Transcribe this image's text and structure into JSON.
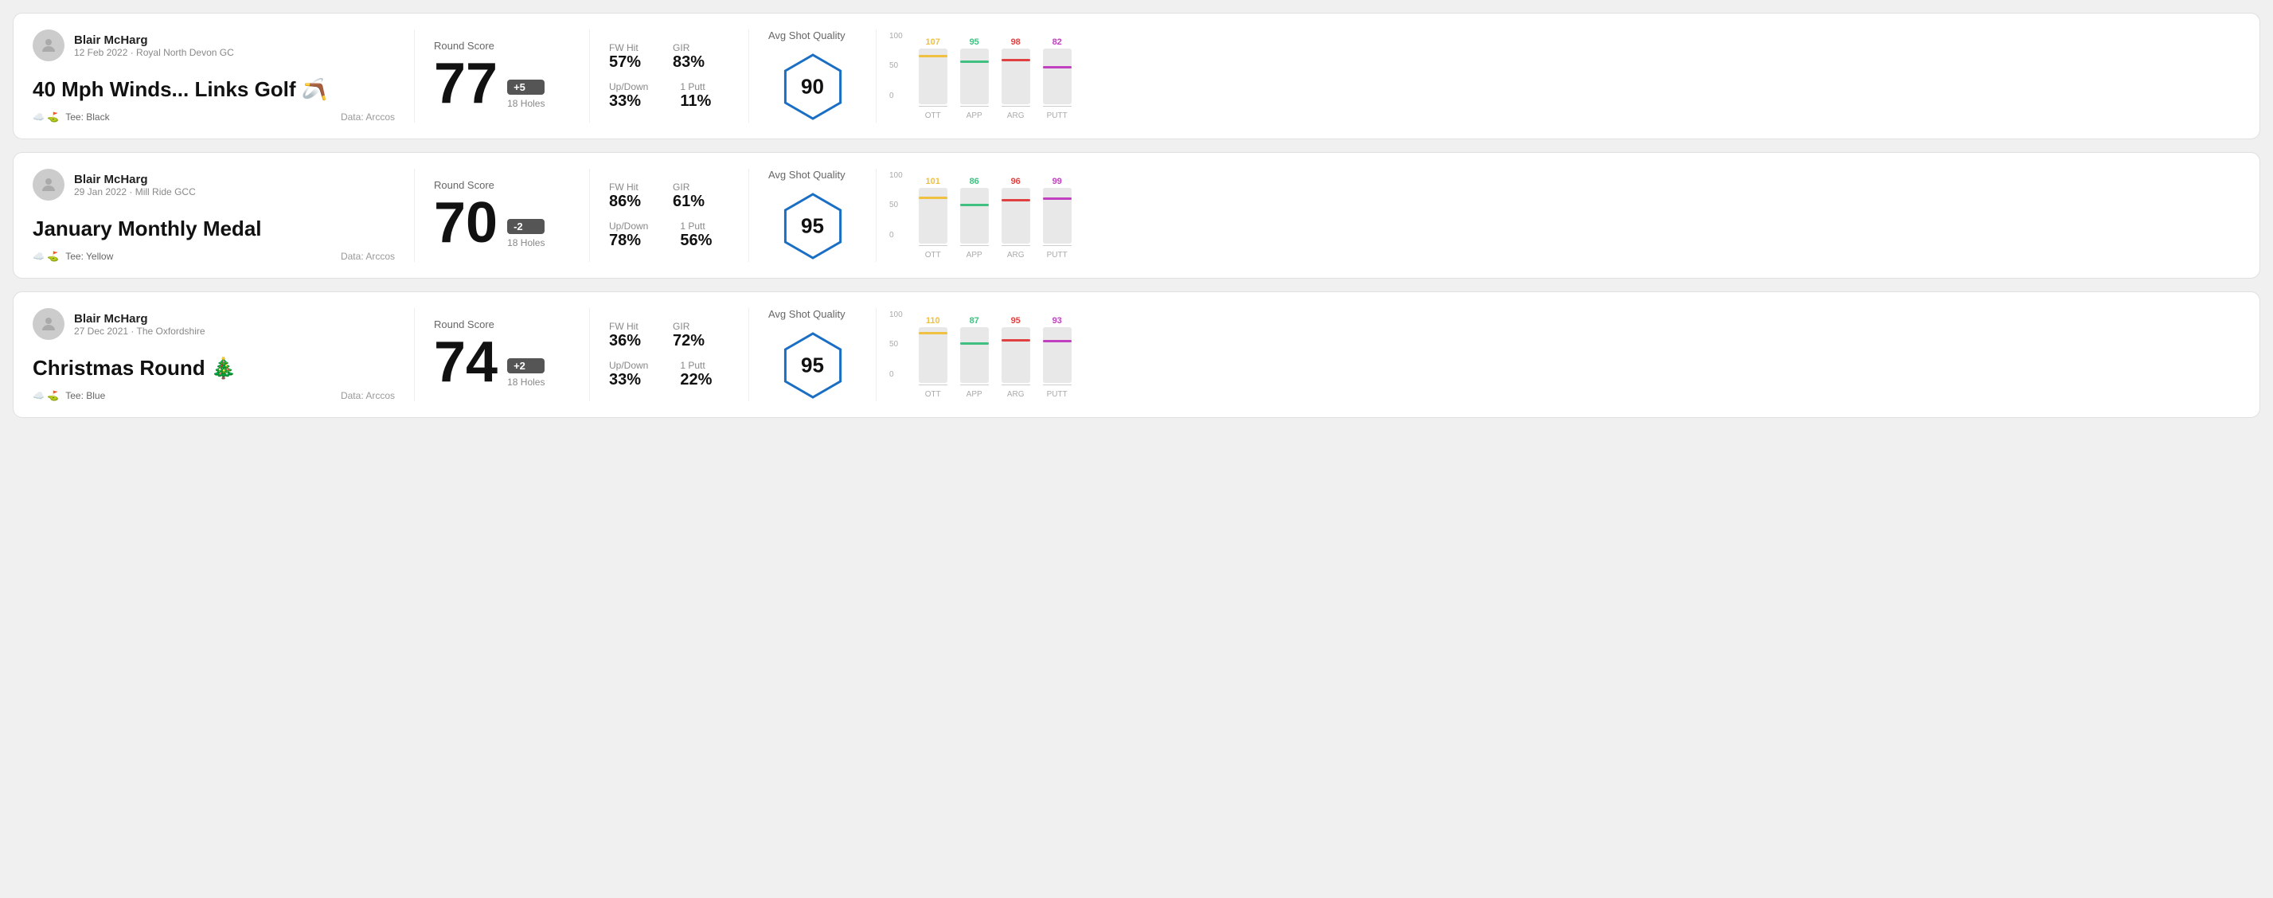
{
  "rounds": [
    {
      "id": "round1",
      "player": "Blair McHarg",
      "date": "12 Feb 2022 · Royal North Devon GC",
      "title": "40 Mph Winds... Links Golf 🪃",
      "tee": "Black",
      "data_source": "Data: Arccos",
      "score": "77",
      "score_diff": "+5",
      "score_diff_type": "over",
      "holes": "18 Holes",
      "fw_hit": "57%",
      "gir": "83%",
      "up_down": "33%",
      "one_putt": "11%",
      "avg_quality": "90",
      "chart": {
        "bars": [
          {
            "label": "OTT",
            "value": 107,
            "color": "#f0c040",
            "max": 120
          },
          {
            "label": "APP",
            "value": 95,
            "color": "#40c080",
            "max": 120
          },
          {
            "label": "ARG",
            "value": 98,
            "color": "#e04040",
            "max": 120
          },
          {
            "label": "PUTT",
            "value": 82,
            "color": "#c040c0",
            "max": 120
          }
        ]
      }
    },
    {
      "id": "round2",
      "player": "Blair McHarg",
      "date": "29 Jan 2022 · Mill Ride GCC",
      "title": "January Monthly Medal",
      "tee": "Yellow",
      "data_source": "Data: Arccos",
      "score": "70",
      "score_diff": "-2",
      "score_diff_type": "under",
      "holes": "18 Holes",
      "fw_hit": "86%",
      "gir": "61%",
      "up_down": "78%",
      "one_putt": "56%",
      "avg_quality": "95",
      "chart": {
        "bars": [
          {
            "label": "OTT",
            "value": 101,
            "color": "#f0c040",
            "max": 120
          },
          {
            "label": "APP",
            "value": 86,
            "color": "#40c080",
            "max": 120
          },
          {
            "label": "ARG",
            "value": 96,
            "color": "#e04040",
            "max": 120
          },
          {
            "label": "PUTT",
            "value": 99,
            "color": "#c040c0",
            "max": 120
          }
        ]
      }
    },
    {
      "id": "round3",
      "player": "Blair McHarg",
      "date": "27 Dec 2021 · The Oxfordshire",
      "title": "Christmas Round 🎄",
      "tee": "Blue",
      "data_source": "Data: Arccos",
      "score": "74",
      "score_diff": "+2",
      "score_diff_type": "over",
      "holes": "18 Holes",
      "fw_hit": "36%",
      "gir": "72%",
      "up_down": "33%",
      "one_putt": "22%",
      "avg_quality": "95",
      "chart": {
        "bars": [
          {
            "label": "OTT",
            "value": 110,
            "color": "#f0c040",
            "max": 120
          },
          {
            "label": "APP",
            "value": 87,
            "color": "#40c080",
            "max": 120
          },
          {
            "label": "ARG",
            "value": 95,
            "color": "#e04040",
            "max": 120
          },
          {
            "label": "PUTT",
            "value": 93,
            "color": "#c040c0",
            "max": 120
          }
        ]
      }
    }
  ],
  "labels": {
    "round_score": "Round Score",
    "fw_hit": "FW Hit",
    "gir": "GIR",
    "up_down": "Up/Down",
    "one_putt": "1 Putt",
    "avg_quality": "Avg Shot Quality",
    "data_prefix": "Data: "
  }
}
